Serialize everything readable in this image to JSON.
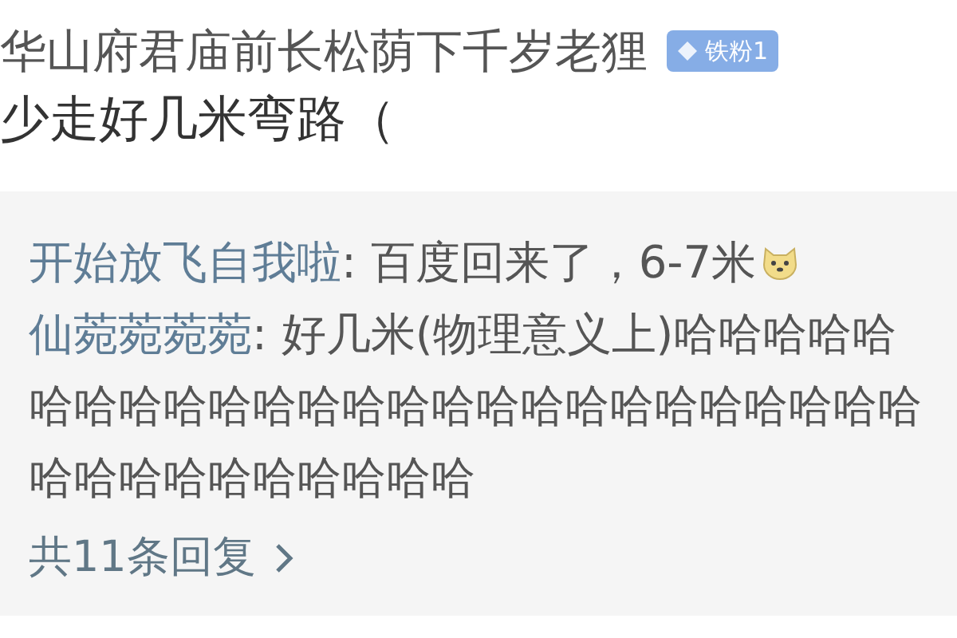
{
  "author": {
    "name": "华山府君庙前长松荫下千岁老狸",
    "badge": "铁粉1"
  },
  "content": "少走好几米弯路（",
  "replies": [
    {
      "user": "开始放飞自我啦",
      "lines": [
        ": 百度回来了，6-7米"
      ],
      "emoji": true
    },
    {
      "user": "仙菀菀菀菀",
      "lines": [
        ": 好几米(物理意义上)哈哈哈哈哈",
        "哈哈哈哈哈哈哈哈哈哈哈哈哈哈哈哈哈哈哈哈",
        "哈哈哈哈哈哈哈哈哈哈"
      ],
      "emoji": false
    }
  ],
  "more_replies": "共11条回复"
}
